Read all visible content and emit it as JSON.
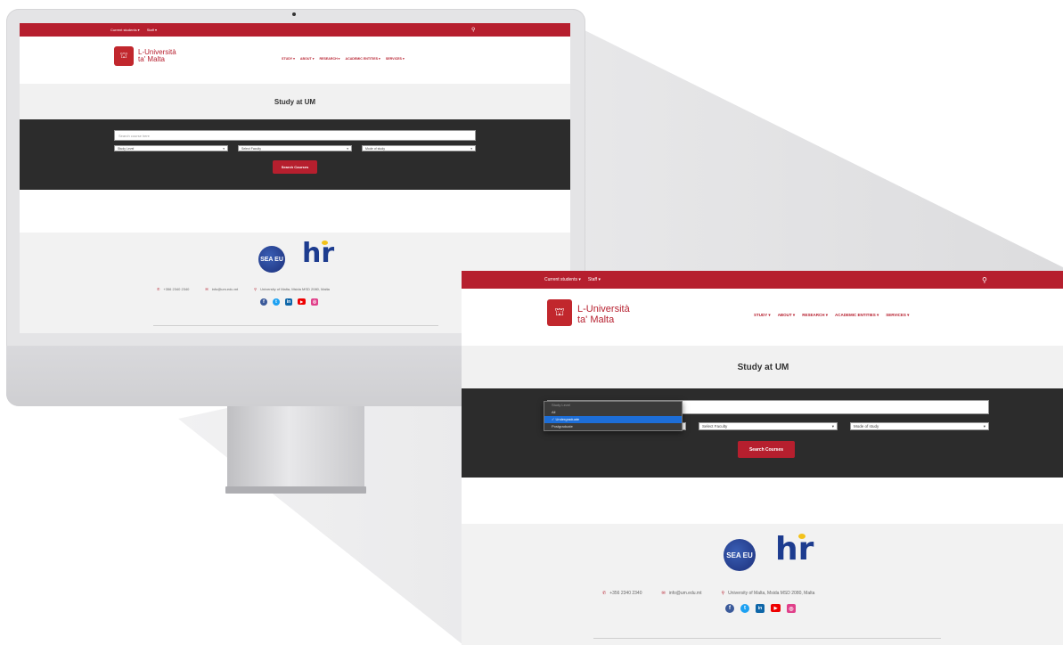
{
  "site": {
    "topbar_links": [
      "Current students ▾",
      "Staff ▾"
    ],
    "search_icon": "search-icon",
    "logo_line1": "L-Università",
    "logo_line2": "ta' Malta",
    "nav": [
      "STUDY ▾",
      "ABOUT ▾",
      "RESEARCH ▾",
      "ACADEMIC ENTITIES ▾",
      "SERVICES ▾"
    ],
    "page_title": "Study at UM",
    "search_placeholder": "Search course here",
    "select_level": "Study Level",
    "select_faculty": "Select Faculty",
    "select_mode": "Mode of study",
    "search_button": "Search Courses",
    "dropdown": {
      "header": "Study Level",
      "items": [
        "All",
        "Undergraduate",
        "Postgraduate"
      ],
      "selected": "Undergraduate"
    },
    "seal_text": "SEA EU",
    "hr_logo": "hr",
    "phone": "+356 2340 2340",
    "email": "info@um.edu.mt",
    "address": "University of Malta, Msida MSD 2080, Malta",
    "social_icons": [
      "facebook-icon",
      "twitter-icon",
      "linkedin-icon",
      "youtube-icon",
      "instagram-icon"
    ]
  },
  "colors": {
    "brand_red": "#b61f2e",
    "search_band": "#2c2c2c",
    "footer_bg": "#f2f2f2",
    "dropdown_highlight": "#1d6ed8"
  }
}
